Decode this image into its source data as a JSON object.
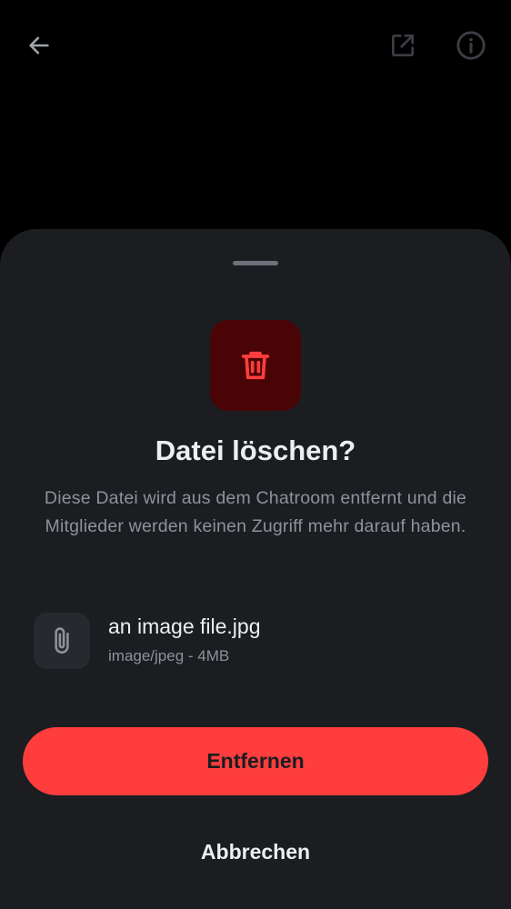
{
  "topbar": {
    "back_icon": "arrow-left-icon",
    "open_external_icon": "open-external-icon",
    "info_icon": "info-circle-icon"
  },
  "dialog": {
    "icon": "trash-icon",
    "title": "Datei löschen?",
    "description": "Diese Datei wird aus dem Chatroom entfernt und die Mitglieder werden keinen Zugriff mehr darauf haben.",
    "file": {
      "icon": "paperclip-icon",
      "name": "an image file.jpg",
      "meta": "image/jpeg - 4MB"
    },
    "confirm_label": "Entfernen",
    "cancel_label": "Abbrechen"
  },
  "colors": {
    "background": "#000000",
    "sheet": "#1b1d21",
    "danger": "#ff3d3d",
    "danger_bg": "#4a0405",
    "text_primary": "#ebeef2",
    "text_secondary": "#8d929b"
  }
}
